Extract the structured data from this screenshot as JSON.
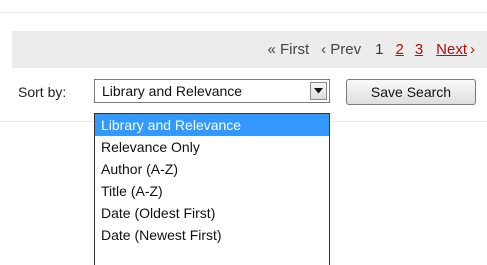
{
  "pagination": {
    "first": "« First",
    "prev": "‹ Prev",
    "current_page": "1",
    "page_2": "2",
    "page_3": "3",
    "next": "Next",
    "next_arrow": "›"
  },
  "sort": {
    "label": "Sort by:",
    "selected": "Library and Relevance",
    "options": [
      "Library and Relevance",
      "Relevance Only",
      "Author (A-Z)",
      "Title (A-Z)",
      "Date (Oldest First)",
      "Date (Newest First)"
    ],
    "highlighted_index": 0
  },
  "actions": {
    "save_search": "Save Search"
  },
  "colors": {
    "link": "#aa1111",
    "highlight": "#3399ff",
    "bar": "#ececec"
  }
}
